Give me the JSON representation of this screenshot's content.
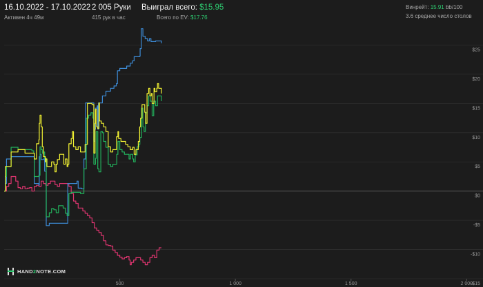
{
  "header": {
    "date_range": "16.10.2022 - 17.10.2022",
    "active_time": "Активен 4ч 49м",
    "hands_total": "2 005 Руки",
    "hands_per_hour": "415 рук в час",
    "won_total_label": "Выиграл всего:",
    "won_total_value": "$15.95",
    "ev_total_label": "Всего по EV:",
    "ev_total_value": "$17.76",
    "winrate_label": "Винрейт:",
    "winrate_value": "15.91",
    "winrate_suffix": "bb/100",
    "avg_tables": "3.6 среднее число столов"
  },
  "logo": {
    "part1": "HAND",
    "part2": "2",
    "part3": "NOTE.COM"
  },
  "colors": {
    "background": "#1c1c1c",
    "won": "#f2f232",
    "ev": "#22b25c",
    "showdown": "#3d8bd6",
    "no_showdown": "#e03570",
    "accent_green": "#2ecc71"
  },
  "chart_data": {
    "type": "line",
    "xlim": [
      0,
      2005
    ],
    "ylim": [
      -15,
      28
    ],
    "x_ticks": [
      {
        "value": 500,
        "label": "500"
      },
      {
        "value": 1000,
        "label": "1 000"
      },
      {
        "value": 1500,
        "label": "1 500"
      },
      {
        "value": 2000,
        "label": "2 000"
      }
    ],
    "y_ticks": [
      {
        "value": 25,
        "label": "$25"
      },
      {
        "value": 20,
        "label": "$20"
      },
      {
        "value": 15,
        "label": "$15"
      },
      {
        "value": 10,
        "label": "$10"
      },
      {
        "value": 5,
        "label": "$5"
      },
      {
        "value": 0,
        "label": "$0"
      },
      {
        "value": -5,
        "label": "-$5"
      },
      {
        "value": -10,
        "label": "-$10"
      },
      {
        "value": -15,
        "label": "-$15"
      }
    ],
    "grid": true,
    "series": [
      {
        "key": "won",
        "color": "#f2f232",
        "points": [
          [
            0,
            0
          ],
          [
            5,
            4.2
          ],
          [
            30,
            6.7
          ],
          [
            60,
            7.1
          ],
          [
            90,
            6.5
          ],
          [
            120,
            6.5
          ],
          [
            128,
            6.5
          ],
          [
            130,
            5.5
          ],
          [
            140,
            8.1
          ],
          [
            150,
            8.8
          ],
          [
            152,
            11.6
          ],
          [
            155,
            13.0
          ],
          [
            160,
            11.0
          ],
          [
            165,
            7.6
          ],
          [
            170,
            5.9
          ],
          [
            178,
            5.0
          ],
          [
            180,
            5.5
          ],
          [
            185,
            4.2
          ],
          [
            195,
            4.2
          ],
          [
            205,
            5.0
          ],
          [
            215,
            4.6
          ],
          [
            220,
            3.3
          ],
          [
            225,
            4.6
          ],
          [
            230,
            5.4
          ],
          [
            240,
            6.3
          ],
          [
            250,
            6.3
          ],
          [
            258,
            4.6
          ],
          [
            265,
            5.5
          ],
          [
            272,
            4.2
          ],
          [
            276,
            4.6
          ],
          [
            280,
            8.1
          ],
          [
            290,
            9.0
          ],
          [
            295,
            10.2
          ],
          [
            300,
            7.6
          ],
          [
            310,
            7.1
          ],
          [
            320,
            7.6
          ],
          [
            330,
            6.7
          ],
          [
            340,
            6.7
          ],
          [
            350,
            8.0
          ],
          [
            360,
            15.0
          ],
          [
            380,
            14.8
          ],
          [
            388,
            6.5
          ],
          [
            393,
            11.6
          ],
          [
            395,
            14.0
          ],
          [
            400,
            11.0
          ],
          [
            405,
            10.7
          ],
          [
            410,
            15.1
          ],
          [
            412,
            12.0
          ],
          [
            420,
            11.6
          ],
          [
            430,
            11.0
          ],
          [
            440,
            10.2
          ],
          [
            450,
            7.6
          ],
          [
            460,
            6.7
          ],
          [
            470,
            7.1
          ],
          [
            480,
            7.1
          ],
          [
            486,
            9.3
          ],
          [
            492,
            10.2
          ],
          [
            495,
            9.0
          ],
          [
            505,
            8.5
          ],
          [
            515,
            8.5
          ],
          [
            525,
            8.0
          ],
          [
            535,
            7.6
          ],
          [
            545,
            7.1
          ],
          [
            556,
            7.5
          ],
          [
            562,
            6.3
          ],
          [
            570,
            7.1
          ],
          [
            580,
            8.5
          ],
          [
            586,
            11.0
          ],
          [
            590,
            12.5
          ],
          [
            596,
            14.8
          ],
          [
            603,
            14.8
          ],
          [
            608,
            13.5
          ],
          [
            612,
            11.6
          ],
          [
            618,
            16.7
          ],
          [
            625,
            17.6
          ],
          [
            630,
            16.3
          ],
          [
            636,
            16.7
          ],
          [
            640,
            15.0
          ],
          [
            648,
            17.6
          ],
          [
            652,
            17.0
          ],
          [
            660,
            17.6
          ],
          [
            663,
            18.4
          ],
          [
            668,
            17.6
          ],
          [
            672,
            17.6
          ],
          [
            680,
            16.7
          ]
        ]
      },
      {
        "key": "ev",
        "color": "#22b25c",
        "points": [
          [
            0,
            0
          ],
          [
            5,
            2.5
          ],
          [
            10,
            4.2
          ],
          [
            30,
            7.5
          ],
          [
            60,
            7.1
          ],
          [
            90,
            7.1
          ],
          [
            120,
            6.9
          ],
          [
            128,
            6.5
          ],
          [
            130,
            2.5
          ],
          [
            140,
            2.5
          ],
          [
            150,
            2.7
          ],
          [
            155,
            7.6
          ],
          [
            160,
            7.1
          ],
          [
            165,
            6.5
          ],
          [
            170,
            6.7
          ],
          [
            175,
            5.6
          ],
          [
            182,
            -4.4
          ],
          [
            195,
            -3.7
          ],
          [
            205,
            -3.0
          ],
          [
            215,
            -3.2
          ],
          [
            225,
            -3.7
          ],
          [
            235,
            -2.5
          ],
          [
            245,
            -2.5
          ],
          [
            255,
            -2.9
          ],
          [
            265,
            -3.8
          ],
          [
            272,
            -4.2
          ],
          [
            280,
            -0.4
          ],
          [
            290,
            -0.2
          ],
          [
            300,
            -0.2
          ],
          [
            310,
            -0.2
          ],
          [
            320,
            -0.2
          ],
          [
            330,
            -0.4
          ],
          [
            340,
            -0.4
          ],
          [
            345,
            3.8
          ],
          [
            355,
            12.5
          ],
          [
            365,
            13.0
          ],
          [
            375,
            13.4
          ],
          [
            384,
            12.5
          ],
          [
            388,
            4.6
          ],
          [
            395,
            5.6
          ],
          [
            398,
            10.2
          ],
          [
            405,
            3.8
          ],
          [
            410,
            3.3
          ],
          [
            418,
            10.2
          ],
          [
            425,
            10.0
          ],
          [
            430,
            8.5
          ],
          [
            440,
            7.5
          ],
          [
            450,
            4.6
          ],
          [
            460,
            4.2
          ],
          [
            470,
            4.6
          ],
          [
            480,
            4.6
          ],
          [
            487,
            6.3
          ],
          [
            492,
            8.5
          ],
          [
            500,
            7.1
          ],
          [
            510,
            6.7
          ],
          [
            520,
            6.3
          ],
          [
            530,
            6.3
          ],
          [
            540,
            5.5
          ],
          [
            546,
            6.3
          ],
          [
            556,
            5.5
          ],
          [
            560,
            5.0
          ],
          [
            567,
            6.2
          ],
          [
            575,
            7.6
          ],
          [
            583,
            8.0
          ],
          [
            587,
            9.2
          ],
          [
            594,
            14.2
          ],
          [
            600,
            11.0
          ],
          [
            605,
            10.2
          ],
          [
            611,
            13.4
          ],
          [
            618,
            14.6
          ],
          [
            625,
            16.3
          ],
          [
            632,
            15.4
          ],
          [
            640,
            12.9
          ],
          [
            647,
            15.4
          ],
          [
            655,
            14.6
          ],
          [
            663,
            16.3
          ],
          [
            670,
            16.3
          ],
          [
            680,
            15.4
          ]
        ]
      },
      {
        "key": "showdown",
        "color": "#3d8bd6",
        "points": [
          [
            0,
            0
          ],
          [
            5,
            1.3
          ],
          [
            10,
            5.5
          ],
          [
            30,
            5.9
          ],
          [
            60,
            5.9
          ],
          [
            90,
            5.9
          ],
          [
            120,
            5.9
          ],
          [
            128,
            5.9
          ],
          [
            130,
            1.3
          ],
          [
            140,
            1.3
          ],
          [
            150,
            1.0
          ],
          [
            152,
            5.9
          ],
          [
            155,
            6.3
          ],
          [
            160,
            5.4
          ],
          [
            170,
            5.5
          ],
          [
            175,
            3.4
          ],
          [
            182,
            -5.9
          ],
          [
            195,
            -5.5
          ],
          [
            210,
            -5.5
          ],
          [
            225,
            -5.5
          ],
          [
            245,
            -5.5
          ],
          [
            265,
            -5.5
          ],
          [
            272,
            -5.5
          ],
          [
            275,
            1.3
          ],
          [
            300,
            1.3
          ],
          [
            315,
            1.7
          ],
          [
            320,
            0.5
          ],
          [
            335,
            0.4
          ],
          [
            345,
            5.5
          ],
          [
            352,
            15.1
          ],
          [
            370,
            15.1
          ],
          [
            383,
            15.1
          ],
          [
            388,
            8.5
          ],
          [
            392,
            10.6
          ],
          [
            395,
            14.2
          ],
          [
            402,
            14.6
          ],
          [
            405,
            10.6
          ],
          [
            408,
            15.1
          ],
          [
            412,
            15.1
          ],
          [
            425,
            16.3
          ],
          [
            440,
            17.1
          ],
          [
            460,
            17.6
          ],
          [
            475,
            18.0
          ],
          [
            485,
            18.4
          ],
          [
            490,
            20.6
          ],
          [
            500,
            21.0
          ],
          [
            520,
            21.0
          ],
          [
            530,
            21.4
          ],
          [
            545,
            21.9
          ],
          [
            555,
            22.3
          ],
          [
            562,
            23.0
          ],
          [
            570,
            23.0
          ],
          [
            585,
            23.1
          ],
          [
            588,
            24.4
          ],
          [
            593,
            27.8
          ],
          [
            600,
            26.5
          ],
          [
            610,
            26.1
          ],
          [
            620,
            25.7
          ],
          [
            628,
            26.1
          ],
          [
            635,
            25.6
          ],
          [
            645,
            25.6
          ],
          [
            655,
            25.7
          ],
          [
            665,
            25.7
          ],
          [
            670,
            25.7
          ],
          [
            680,
            25.3
          ]
        ]
      },
      {
        "key": "no_showdown",
        "color": "#e03570",
        "points": [
          [
            0,
            0
          ],
          [
            10,
            0.8
          ],
          [
            20,
            1.3
          ],
          [
            30,
            2.5
          ],
          [
            40,
            2.5
          ],
          [
            50,
            1.7
          ],
          [
            60,
            0.6
          ],
          [
            70,
            0.4
          ],
          [
            80,
            0.8
          ],
          [
            90,
            0.4
          ],
          [
            100,
            0.5
          ],
          [
            110,
            0.6
          ],
          [
            120,
            0.0
          ],
          [
            130,
            0.8
          ],
          [
            140,
            1.0
          ],
          [
            150,
            0.8
          ],
          [
            160,
            1.7
          ],
          [
            170,
            1.3
          ],
          [
            180,
            1.0
          ],
          [
            190,
            1.3
          ],
          [
            200,
            1.7
          ],
          [
            210,
            1.7
          ],
          [
            220,
            1.1
          ],
          [
            230,
            0.8
          ],
          [
            240,
            1.3
          ],
          [
            250,
            1.3
          ],
          [
            260,
            1.3
          ],
          [
            270,
            1.3
          ],
          [
            280,
            0.8
          ],
          [
            290,
            -0.4
          ],
          [
            300,
            -1.7
          ],
          [
            310,
            -2.1
          ],
          [
            320,
            -2.9
          ],
          [
            330,
            -2.9
          ],
          [
            340,
            -3.4
          ],
          [
            350,
            -3.8
          ],
          [
            360,
            -4.2
          ],
          [
            370,
            -4.6
          ],
          [
            380,
            -5.4
          ],
          [
            390,
            -6.3
          ],
          [
            400,
            -6.7
          ],
          [
            410,
            -7.1
          ],
          [
            420,
            -7.6
          ],
          [
            430,
            -8.5
          ],
          [
            440,
            -9.2
          ],
          [
            450,
            -9.3
          ],
          [
            460,
            -9.4
          ],
          [
            470,
            -10.1
          ],
          [
            480,
            -10.5
          ],
          [
            490,
            -11.0
          ],
          [
            500,
            -11.3
          ],
          [
            510,
            -11.6
          ],
          [
            520,
            -11.4
          ],
          [
            530,
            -11.2
          ],
          [
            540,
            -11.8
          ],
          [
            545,
            -12.6
          ],
          [
            550,
            -12.2
          ],
          [
            560,
            -11.8
          ],
          [
            570,
            -11.4
          ],
          [
            580,
            -11.4
          ],
          [
            590,
            -11.8
          ],
          [
            600,
            -12.2
          ],
          [
            610,
            -12.6
          ],
          [
            620,
            -12.2
          ],
          [
            630,
            -11.4
          ],
          [
            640,
            -11.0
          ],
          [
            650,
            -11.4
          ],
          [
            660,
            -10.1
          ],
          [
            670,
            -9.7
          ],
          [
            680,
            -9.7
          ]
        ]
      }
    ]
  }
}
